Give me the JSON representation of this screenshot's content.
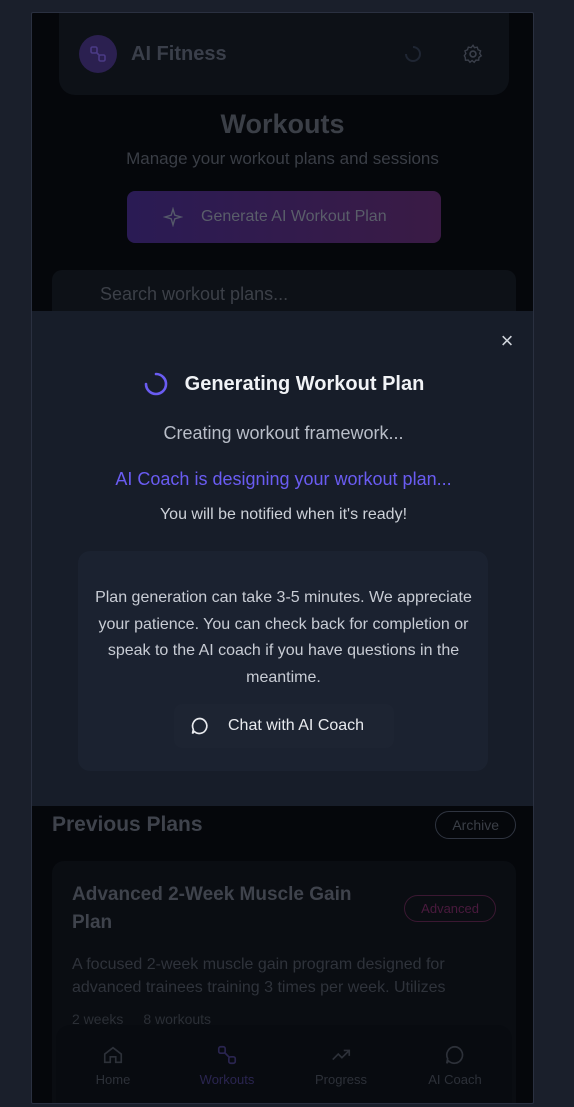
{
  "app": {
    "title": "AI Fitness"
  },
  "page": {
    "title": "Workouts",
    "subtitle": "Manage your workout plans and sessions",
    "generate_button": "Generate AI Workout Plan",
    "search_placeholder": "Search workout plans..."
  },
  "previous": {
    "title": "Previous Plans",
    "archive_label": "Archive",
    "plan": {
      "name": "Advanced 2-Week Muscle Gain Plan",
      "badge": "Advanced",
      "description": "A focused 2-week muscle gain program designed for advanced trainees training 3 times per week. Utilizes",
      "duration": "2 weeks",
      "sessions": "8 workouts"
    }
  },
  "modal": {
    "close": "×",
    "title": "Generating Workout Plan",
    "status": "Creating workout framework...",
    "designing": "AI Coach is designing your workout plan...",
    "notify": "You will be notified when it's ready!",
    "info": "Plan generation can take 3-5 minutes. We appreciate your patience. You can check back for completion or speak to the AI coach if you have questions in the meantime.",
    "chat_button": "Chat with AI Coach"
  },
  "nav": {
    "items": [
      {
        "label": "Home",
        "icon": "home-icon"
      },
      {
        "label": "Workouts",
        "icon": "dumbbell-icon",
        "active": true
      },
      {
        "label": "Progress",
        "icon": "trend-icon"
      },
      {
        "label": "AI Coach",
        "icon": "chat-icon"
      }
    ]
  },
  "colors": {
    "accent": "#6a5cf2",
    "modal_bg": "#171d29",
    "page_bg": "#05070b"
  }
}
